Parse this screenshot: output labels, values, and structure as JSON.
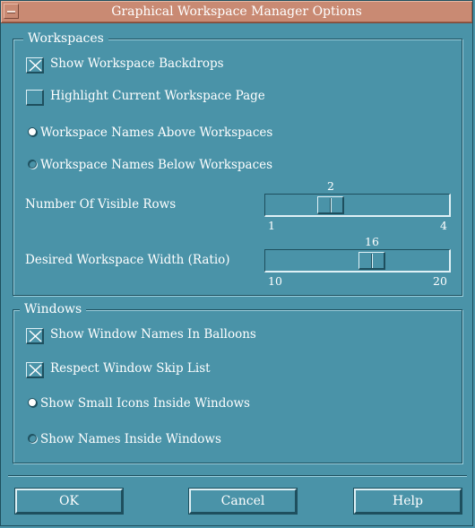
{
  "window": {
    "title": "Graphical Workspace Manager Options"
  },
  "workspaces": {
    "label": "Workspaces",
    "show_backdrops": {
      "label": "Show Workspace Backdrops",
      "checked": true
    },
    "highlight_current": {
      "label": "Highlight Current Workspace Page",
      "checked": false
    },
    "names_position": {
      "options": [
        {
          "label": "Workspace Names Above Workspaces",
          "selected": true
        },
        {
          "label": "Workspace Names Below Workspaces",
          "selected": false
        }
      ]
    },
    "visible_rows": {
      "label": "Number Of Visible Rows",
      "value": "2",
      "min": "1",
      "max": "4"
    },
    "width_ratio": {
      "label": "Desired Workspace Width (Ratio)",
      "value": "16",
      "min": "10",
      "max": "20"
    }
  },
  "windows": {
    "label": "Windows",
    "names_in_balloons": {
      "label": "Show Window Names In Balloons",
      "checked": true
    },
    "skip_list": {
      "label": "Respect Window Skip List",
      "checked": true
    },
    "display": {
      "options": [
        {
          "label": "Show Small Icons Inside Windows",
          "selected": true
        },
        {
          "label": "Show Names Inside Windows",
          "selected": false
        }
      ]
    }
  },
  "buttons": {
    "ok": "OK",
    "cancel": "Cancel",
    "help": "Help"
  },
  "colors": {
    "background": "#4a93a8",
    "titlebar": "#c98a73",
    "shadow": "#1e4f5e",
    "highlight": "#dff1f6"
  }
}
